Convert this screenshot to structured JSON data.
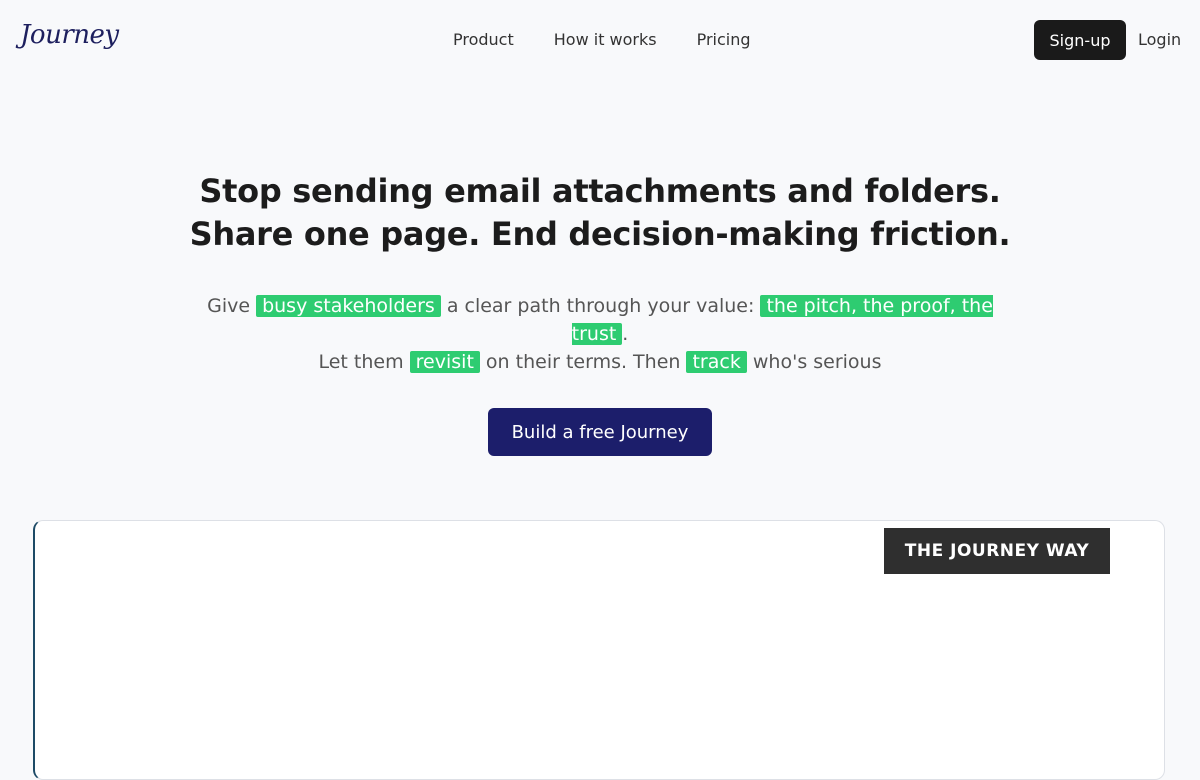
{
  "header": {
    "logo": "Journey",
    "nav": [
      "Product",
      "How it works",
      "Pricing"
    ],
    "signup_label": "Sign-up",
    "login_label": "Login"
  },
  "hero": {
    "headline_line1": "Stop sending email attachments and folders.",
    "headline_line2": "Share one page. End decision-making friction.",
    "sub": {
      "p1": "Give ",
      "h1": "busy stakeholders",
      "p2": " a clear path through your value: ",
      "h2": "the pitch, the proof, the trust",
      "p3": ".",
      "p4": "Let them ",
      "h3": "revisit",
      "p5": " on their terms. Then ",
      "h4": "track",
      "p6": " who's serious"
    },
    "cta_label": "Build a free Journey"
  },
  "showcase": {
    "badge": "THE JOURNEY WAY"
  },
  "colors": {
    "accent_navy": "#1c1e6b",
    "highlight_green": "#2ecc71",
    "dark": "#1a1a1a"
  }
}
